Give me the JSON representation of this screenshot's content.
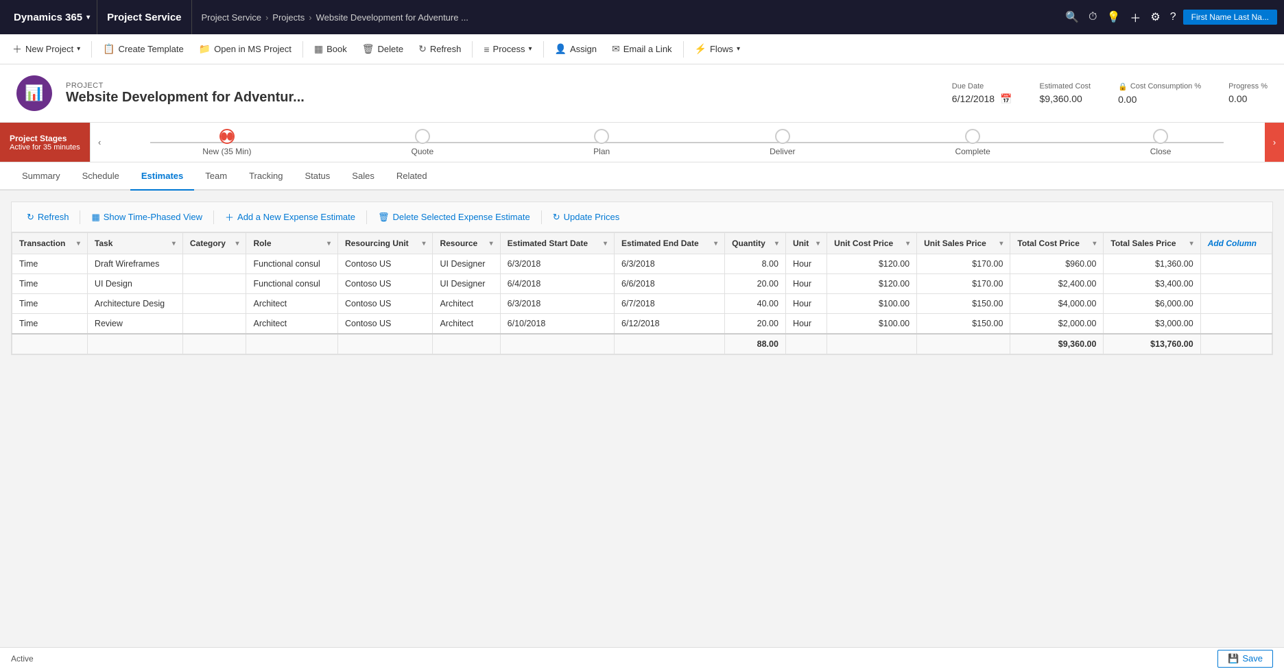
{
  "topNav": {
    "dynamics": "Dynamics 365",
    "chevron": "▾",
    "app": "Project Service",
    "breadcrumb": [
      "Project Service",
      "Projects",
      "Website Development for Adventure ..."
    ],
    "icons": [
      "🔍",
      "⏱",
      "💡",
      "＋"
    ],
    "settings": "⚙",
    "help": "?",
    "user": "First Name Last Na..."
  },
  "commandBar": {
    "buttons": [
      {
        "label": "New Project",
        "icon": "＋",
        "hasDropdown": true
      },
      {
        "label": "Create Template",
        "icon": "📋",
        "hasDropdown": false
      },
      {
        "label": "Open in MS Project",
        "icon": "📁",
        "hasDropdown": false
      },
      {
        "label": "Book",
        "icon": "▦",
        "hasDropdown": false
      },
      {
        "label": "Delete",
        "icon": "🗑",
        "hasDropdown": false
      },
      {
        "label": "Refresh",
        "icon": "↻",
        "hasDropdown": false
      },
      {
        "label": "Process",
        "icon": "≡",
        "hasDropdown": true
      },
      {
        "label": "Assign",
        "icon": "👤",
        "hasDropdown": false
      },
      {
        "label": "Email a Link",
        "icon": "✉",
        "hasDropdown": false
      },
      {
        "label": "Flows",
        "icon": "⚡",
        "hasDropdown": true
      }
    ]
  },
  "project": {
    "label": "PROJECT",
    "title": "Website Development for Adventur...",
    "icon": "📊",
    "dueDate": {
      "label": "Due Date",
      "value": "6/12/2018"
    },
    "estimatedCost": {
      "label": "Estimated Cost",
      "value": "$9,360.00"
    },
    "costConsumption": {
      "label": "Cost Consumption %",
      "value": "0.00"
    },
    "progress": {
      "label": "Progress %",
      "value": "0.00"
    }
  },
  "pipeline": {
    "stagesLabel": "Project Stages",
    "activeLabel": "Active for 35 minutes",
    "stages": [
      {
        "name": "New  (35 Min)",
        "active": true
      },
      {
        "name": "Quote",
        "active": false
      },
      {
        "name": "Plan",
        "active": false
      },
      {
        "name": "Deliver",
        "active": false
      },
      {
        "name": "Complete",
        "active": false
      },
      {
        "name": "Close",
        "active": false
      }
    ]
  },
  "tabs": [
    {
      "label": "Summary",
      "active": false
    },
    {
      "label": "Schedule",
      "active": false
    },
    {
      "label": "Estimates",
      "active": true
    },
    {
      "label": "Team",
      "active": false
    },
    {
      "label": "Tracking",
      "active": false
    },
    {
      "label": "Status",
      "active": false
    },
    {
      "label": "Sales",
      "active": false
    },
    {
      "label": "Related",
      "active": false
    }
  ],
  "estimates": {
    "toolbar": {
      "refresh": "Refresh",
      "showTimePhasedView": "Show Time-Phased View",
      "addNewExpense": "Add a New Expense Estimate",
      "deleteSelected": "Delete Selected Expense Estimate",
      "updatePrices": "Update Prices"
    },
    "columns": [
      {
        "key": "transaction",
        "label": "Transaction"
      },
      {
        "key": "task",
        "label": "Task"
      },
      {
        "key": "category",
        "label": "Category"
      },
      {
        "key": "role",
        "label": "Role"
      },
      {
        "key": "resourcingUnit",
        "label": "Resourcing Unit"
      },
      {
        "key": "resource",
        "label": "Resource"
      },
      {
        "key": "startDate",
        "label": "Estimated Start Date"
      },
      {
        "key": "endDate",
        "label": "Estimated End Date"
      },
      {
        "key": "quantity",
        "label": "Quantity"
      },
      {
        "key": "unit",
        "label": "Unit"
      },
      {
        "key": "unitCostPrice",
        "label": "Unit Cost Price"
      },
      {
        "key": "unitSalesPrice",
        "label": "Unit Sales Price"
      },
      {
        "key": "totalCostPrice",
        "label": "Total Cost Price"
      },
      {
        "key": "totalSalesPrice",
        "label": "Total Sales Price"
      },
      {
        "key": "addColumn",
        "label": "Add Column"
      }
    ],
    "rows": [
      {
        "transaction": "Time",
        "task": "Draft Wireframes",
        "category": "",
        "role": "Functional consul",
        "resourcingUnit": "Contoso US",
        "resource": "UI Designer",
        "startDate": "6/3/2018",
        "endDate": "6/3/2018",
        "quantity": "8.00",
        "unit": "Hour",
        "unitCostPrice": "$120.00",
        "unitSalesPrice": "$170.00",
        "totalCostPrice": "$960.00",
        "totalSalesPrice": "$1,360.00"
      },
      {
        "transaction": "Time",
        "task": "UI Design",
        "category": "",
        "role": "Functional consul",
        "resourcingUnit": "Contoso US",
        "resource": "UI Designer",
        "startDate": "6/4/2018",
        "endDate": "6/6/2018",
        "quantity": "20.00",
        "unit": "Hour",
        "unitCostPrice": "$120.00",
        "unitSalesPrice": "$170.00",
        "totalCostPrice": "$2,400.00",
        "totalSalesPrice": "$3,400.00"
      },
      {
        "transaction": "Time",
        "task": "Architecture Desig",
        "category": "",
        "role": "Architect",
        "resourcingUnit": "Contoso US",
        "resource": "Architect",
        "startDate": "6/3/2018",
        "endDate": "6/7/2018",
        "quantity": "40.00",
        "unit": "Hour",
        "unitCostPrice": "$100.00",
        "unitSalesPrice": "$150.00",
        "totalCostPrice": "$4,000.00",
        "totalSalesPrice": "$6,000.00"
      },
      {
        "transaction": "Time",
        "task": "Review",
        "category": "",
        "role": "Architect",
        "resourcingUnit": "Contoso US",
        "resource": "Architect",
        "startDate": "6/10/2018",
        "endDate": "6/12/2018",
        "quantity": "20.00",
        "unit": "Hour",
        "unitCostPrice": "$100.00",
        "unitSalesPrice": "$150.00",
        "totalCostPrice": "$2,000.00",
        "totalSalesPrice": "$3,000.00"
      }
    ],
    "footer": {
      "quantity": "88.00",
      "totalCostPrice": "$9,360.00",
      "totalSalesPrice": "$13,760.00"
    }
  },
  "statusBar": {
    "status": "Active",
    "saveLabel": "Save",
    "saveIcon": "💾"
  }
}
